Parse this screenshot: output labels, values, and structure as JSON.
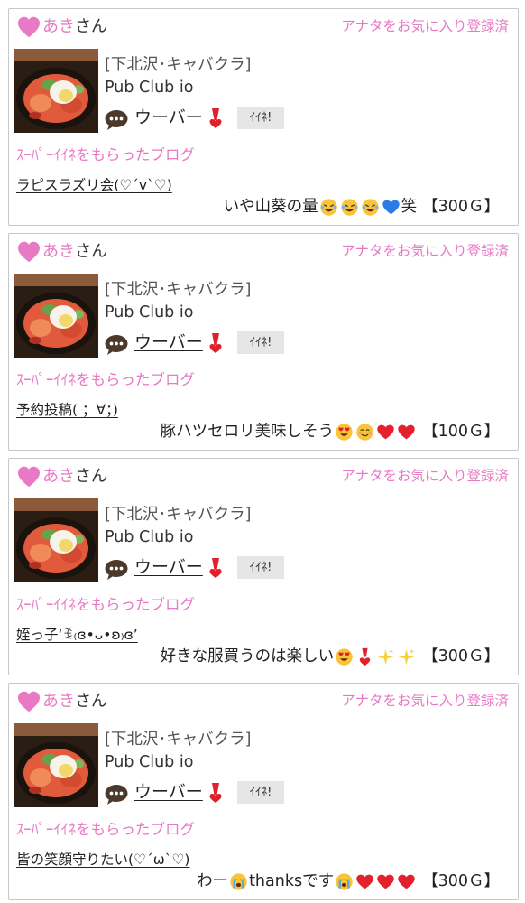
{
  "colors": {
    "accent_pink": "#e879c4",
    "border": "#c8c8c8",
    "button_bg": "#e6e6e6"
  },
  "cards": [
    {
      "user_name": "あき",
      "name_suffix": "さん",
      "favorite_status": "アナタをお気に入り登録済",
      "shop_area": "[下北沢･キャバクラ]",
      "shop_name": "Pub Club io",
      "staff_name": "ウーバー",
      "staff_mark": "exclamation-heart-icon",
      "iine_button": "ｲｲﾈ!",
      "super_label": "ｽｰﾊﾟｰｲｲﾈをもらったブログ",
      "blog_title": "ラピスラズリ会(♡ˊvˋ♡)",
      "comment_text": "いや山葵の量",
      "comment_suffix": "笑",
      "emojis": [
        "rofl-emoji",
        "rofl-emoji",
        "rofl-emoji",
        "blue-heart-emoji"
      ],
      "points": "【300Ｇ】"
    },
    {
      "user_name": "あき",
      "name_suffix": "さん",
      "favorite_status": "アナタをお気に入り登録済",
      "shop_area": "[下北沢･キャバクラ]",
      "shop_name": "Pub Club io",
      "staff_name": "ウーバー",
      "staff_mark": "exclamation-heart-icon",
      "iine_button": "ｲｲﾈ!",
      "super_label": "ｽｰﾊﾟｰｲｲﾈをもらったブログ",
      "blog_title": "予約投稿( ；∀；)",
      "comment_text": "豚ハツセロリ美味しそう",
      "comment_suffix": "",
      "emojis": [
        "heart-eyes-emoji",
        "smiling-emoji",
        "red-heart-emoji",
        "red-heart-emoji"
      ],
      "points": "【100Ｇ】"
    },
    {
      "user_name": "あき",
      "name_suffix": "さん",
      "favorite_status": "アナタをお気に入り登録済",
      "shop_area": "[下北沢･キャバクラ]",
      "shop_name": "Pub Club io",
      "staff_name": "ウーバー",
      "staff_mark": "exclamation-heart-icon",
      "iine_button": "ｲｲﾈ!",
      "super_label": "ｽｰﾊﾟｰｲｲﾈをもらったブログ",
      "blog_title": "姪っ子‘ꉂ₍ɞ•ᴗ•ʚ₎ɞ’",
      "comment_text": "好きな服買うのは楽しい",
      "comment_suffix": "",
      "emojis": [
        "heart-eyes-emoji",
        "exclamation-heart-emoji",
        "sparkles-emoji",
        "sparkles-emoji"
      ],
      "points": "【300Ｇ】"
    },
    {
      "user_name": "あき",
      "name_suffix": "さん",
      "favorite_status": "アナタをお気に入り登録済",
      "shop_area": "[下北沢･キャバクラ]",
      "shop_name": "Pub Club io",
      "staff_name": "ウーバー",
      "staff_mark": "exclamation-heart-icon",
      "iine_button": "ｲｲﾈ!",
      "super_label": "ｽｰﾊﾟｰｲｲﾈをもらったブログ",
      "blog_title": "皆の笑顔守りたい(♡ˊωˋ♡)",
      "comment_text": "わー",
      "comment_middle": "thanksです",
      "comment_suffix": "",
      "emojis_before": [
        "crying-emoji"
      ],
      "emojis": [
        "crying-emoji",
        "red-heart-emoji",
        "red-heart-emoji",
        "red-heart-emoji"
      ],
      "points": "【300Ｇ】"
    }
  ]
}
